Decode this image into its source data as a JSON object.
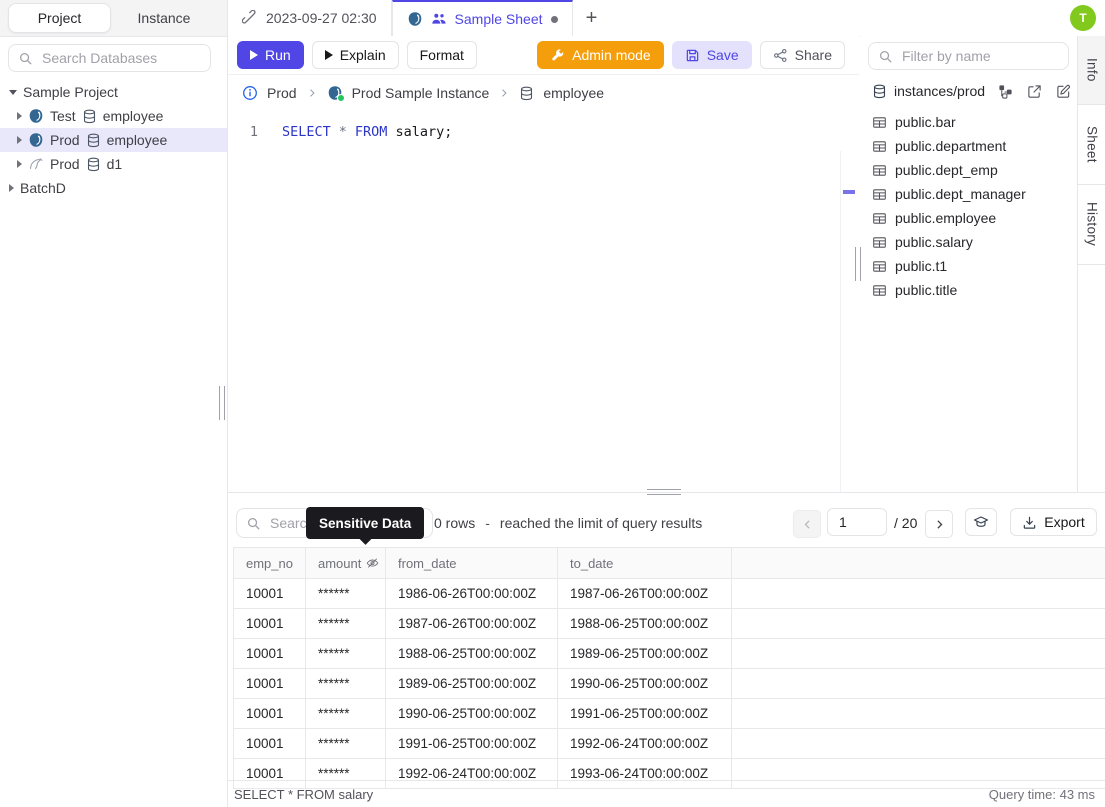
{
  "colors": {
    "accent": "#4f46e5",
    "admin": "#f59e0b",
    "avatar_green": "#82c91e",
    "keyword_blue": "#2d35c8"
  },
  "left_sidebar": {
    "tabs": [
      {
        "label": "Project"
      },
      {
        "label": "Instance"
      }
    ],
    "search_placeholder": "Search Databases",
    "tree": {
      "root_label": "Sample Project",
      "items": [
        {
          "env": "Test",
          "database": "employee",
          "engine": "postgresql"
        },
        {
          "env": "Prod",
          "database": "employee",
          "engine": "postgresql"
        },
        {
          "env": "Prod",
          "database": "d1",
          "engine": "mysql"
        }
      ],
      "collapsed_root": "BatchD"
    }
  },
  "tab_bar": {
    "history_tab_label": "2023-09-27 02:30",
    "active_tab_label": "Sample Sheet",
    "new_tab_label": "+",
    "avatar_letter": "T"
  },
  "toolbar": {
    "run_label": "Run",
    "explain_label": "Explain",
    "format_label": "Format",
    "admin_mode_label": "Admin mode",
    "save_label": "Save",
    "share_label": "Share"
  },
  "breadcrumb": {
    "environment": "Prod",
    "instance": "Prod Sample Instance",
    "database": "employee"
  },
  "editor": {
    "line_number": "1",
    "keyword1": "SELECT",
    "operator": "*",
    "keyword2": "FROM",
    "identifier": "salary;"
  },
  "right_sidebar": {
    "filter_placeholder": "Filter by name",
    "connection_label": "instances/prod",
    "tables": [
      "public.bar",
      "public.department",
      "public.dept_emp",
      "public.dept_manager",
      "public.employee",
      "public.salary",
      "public.t1",
      "public.title"
    ],
    "panel_tabs": [
      {
        "label": "Info"
      },
      {
        "label": "Sheet"
      },
      {
        "label": "History"
      }
    ]
  },
  "results_panel": {
    "search_placeholder": "Search",
    "tooltip_label": "Sensitive Data",
    "row_count": "0 rows",
    "separator": "-",
    "limit_message": "reached the limit of query results",
    "page_value": "1",
    "page_total": "/ 20",
    "export_label": "Export",
    "table": {
      "columns": [
        "emp_no",
        "amount",
        "from_date",
        "to_date"
      ],
      "rows": [
        [
          "10001",
          "******",
          "1986-06-26T00:00:00Z",
          "1987-06-26T00:00:00Z"
        ],
        [
          "10001",
          "******",
          "1987-06-26T00:00:00Z",
          "1988-06-25T00:00:00Z"
        ],
        [
          "10001",
          "******",
          "1988-06-25T00:00:00Z",
          "1989-06-25T00:00:00Z"
        ],
        [
          "10001",
          "******",
          "1989-06-25T00:00:00Z",
          "1990-06-25T00:00:00Z"
        ],
        [
          "10001",
          "******",
          "1990-06-25T00:00:00Z",
          "1991-06-25T00:00:00Z"
        ],
        [
          "10001",
          "******",
          "1991-06-25T00:00:00Z",
          "1992-06-24T00:00:00Z"
        ],
        [
          "10001",
          "******",
          "1992-06-24T00:00:00Z",
          "1993-06-24T00:00:00Z"
        ]
      ]
    },
    "status_query": "SELECT * FROM salary",
    "query_time": "Query time: 43 ms"
  }
}
